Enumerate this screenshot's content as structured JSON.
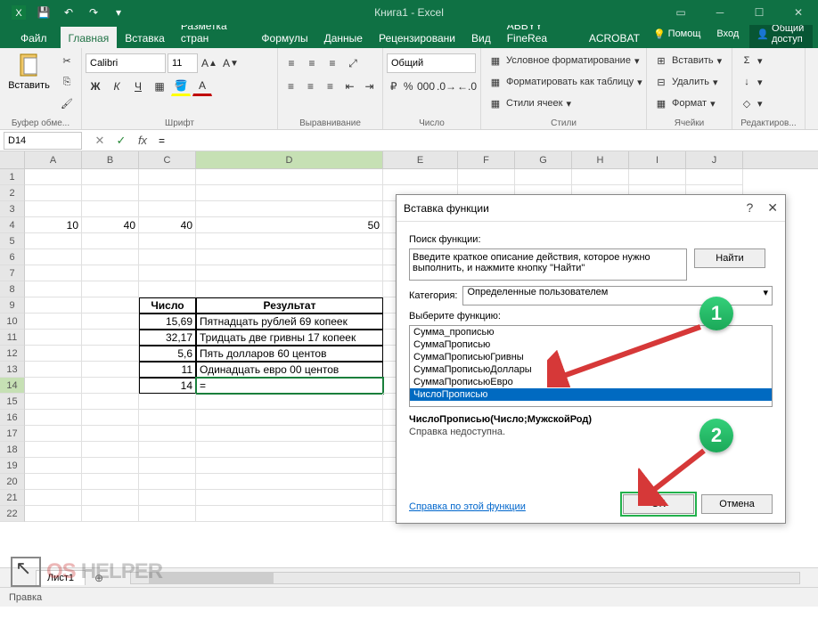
{
  "title": "Книга1 - Excel",
  "qat": {
    "save": "💾",
    "undo": "↶",
    "redo": "↷"
  },
  "tabs": [
    "Файл",
    "Главная",
    "Вставка",
    "Разметка стран",
    "Формулы",
    "Данные",
    "Рецензировани",
    "Вид",
    "ABBYY FineRea",
    "ACROBAT"
  ],
  "active_tab": 1,
  "right_items": {
    "help": "Помощ",
    "login": "Вход",
    "share": "Общий доступ"
  },
  "ribbon": {
    "clipboard": {
      "label": "Буфер обме...",
      "paste": "Вставить"
    },
    "font": {
      "label": "Шрифт",
      "name": "Calibri",
      "size": "11"
    },
    "align": {
      "label": "Выравнивание"
    },
    "number": {
      "label": "Число",
      "fmt": "Общий"
    },
    "styles": {
      "label": "Стили",
      "cond": "Условное форматирование",
      "table": "Форматировать как таблицу",
      "cell": "Стили ячеек"
    },
    "cells": {
      "label": "Ячейки",
      "ins": "Вставить",
      "del": "Удалить",
      "fmt": "Формат"
    },
    "editing": {
      "label": "Редактиров..."
    }
  },
  "namebox": "D14",
  "formula": "=",
  "cols": [
    "A",
    "B",
    "C",
    "D",
    "E",
    "F",
    "G",
    "H",
    "I",
    "J"
  ],
  "colw": [
    "wA",
    "wB",
    "wC",
    "wD",
    "wE",
    "wF",
    "wG",
    "wH",
    "wI",
    "wJ"
  ],
  "table": {
    "r4": {
      "A": "10",
      "B": "40",
      "C": "40",
      "D": "50"
    },
    "hdr": {
      "C": "Число",
      "D": "Результат"
    },
    "d10": {
      "C": "15,69",
      "D": "Пятнадцать рублей 69 копеек"
    },
    "d11": {
      "C": "32,17",
      "D": "Тридцать две гривны 17 копеек"
    },
    "d12": {
      "C": "5,6",
      "D": "Пять долларов 60 центов"
    },
    "d13": {
      "C": "11",
      "D": "Одинадцать евро 00 центов"
    },
    "d14": {
      "C": "14",
      "D": "="
    }
  },
  "sheet": "Лист1",
  "status": "Правка",
  "dialog": {
    "title": "Вставка функции",
    "search_label": "Поиск функции:",
    "search_text": "Введите краткое описание действия, которое нужно выполнить, и нажмите кнопку \"Найти\"",
    "find": "Найти",
    "cat_label": "Категория:",
    "cat_value": "Определенные пользователем",
    "select_label": "Выберите функцию:",
    "functions": [
      "Сумма_прописью",
      "СуммаПрописью",
      "СуммаПрописьюГривны",
      "СуммаПрописьюДоллары",
      "СуммаПрописьюЕвро",
      "ЧислоПрописью"
    ],
    "selected_idx": 5,
    "signature": "ЧислоПрописью(Число;МужскойРод)",
    "hint": "Справка недоступна.",
    "link": "Справка по этой функции",
    "ok": "OK",
    "cancel": "Отмена"
  },
  "markers": {
    "m1": "1",
    "m2": "2"
  },
  "logo": {
    "p1": "OS",
    "p2": "HELPER"
  }
}
